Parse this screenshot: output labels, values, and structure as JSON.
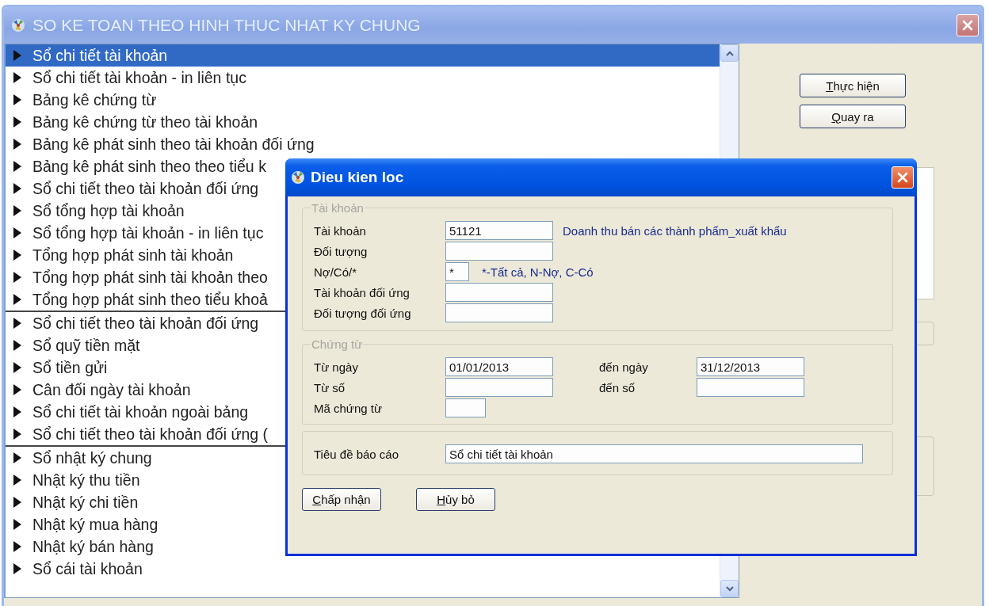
{
  "window": {
    "title": "SO KE TOAN THEO HINH THUC NHAT KY CHUNG"
  },
  "report_list": {
    "groups": [
      {
        "items": [
          {
            "label": "Sổ chi tiết tài khoản",
            "selected": true
          },
          {
            "label": "Sổ chi tiết tài khoản - in liên tục",
            "selected": false
          },
          {
            "label": "Bảng kê chứng từ",
            "selected": false
          },
          {
            "label": "Bảng kê chứng từ theo tài khoản",
            "selected": false
          },
          {
            "label": "Bảng kê phát sinh theo tài khoản đối ứng",
            "selected": false
          },
          {
            "label": "Bảng kê phát sinh theo theo tiểu k",
            "selected": false
          },
          {
            "label": "Sổ chi tiết theo tài khoản đối ứng",
            "selected": false
          },
          {
            "label": "Sổ tổng hợp tài khoản",
            "selected": false
          },
          {
            "label": "Sổ tổng hợp tài khoản - in liên tục",
            "selected": false
          },
          {
            "label": "Tổng hợp phát sinh tài khoản",
            "selected": false
          },
          {
            "label": "Tổng hợp phát sinh tài khoản theo",
            "selected": false
          },
          {
            "label": "Tổng hợp phát sinh theo tiểu khoả",
            "selected": false
          }
        ]
      },
      {
        "items": [
          {
            "label": "Sổ chi tiết theo tài khoản đối ứng",
            "selected": false
          },
          {
            "label": "Sổ quỹ tiền mặt",
            "selected": false
          },
          {
            "label": "Sổ tiền gửi",
            "selected": false
          },
          {
            "label": "Cân đối ngày tài khoản",
            "selected": false
          },
          {
            "label": "Sổ chi tiết tài khoản ngoài bảng",
            "selected": false
          },
          {
            "label": "Sổ chi tiết theo tài khoản đối ứng (",
            "selected": false
          }
        ]
      },
      {
        "items": [
          {
            "label": "Sổ nhật ký chung",
            "selected": false
          },
          {
            "label": "Nhật ký thu tiền",
            "selected": false
          },
          {
            "label": "Nhật ký chi tiền",
            "selected": false
          },
          {
            "label": "Nhật ký mua hàng",
            "selected": false
          },
          {
            "label": "Nhật ký bán hàng",
            "selected": false
          },
          {
            "label": "Sổ cái tài khoản",
            "selected": false
          }
        ]
      }
    ]
  },
  "side_buttons": [
    "Thực hiện",
    "Quay ra"
  ],
  "dialog": {
    "title": "Dieu kien loc",
    "account_group": {
      "legend": "Tài khoản",
      "fields": [
        {
          "label": "Tài khoản",
          "value": "51121",
          "kind": "medium",
          "note": "Doanh thu bán các thành phẩm_xuất khẩu"
        },
        {
          "label": "Đối tượng",
          "kind": "medium"
        },
        {
          "label": "Nợ/Có/*",
          "value": "*",
          "kind": "tiny",
          "note": "*-Tất cả, N-Nợ, C-Có"
        },
        {
          "label": "Tài khoản đối ứng",
          "kind": "medium"
        },
        {
          "label": "Đối tượng đối ứng",
          "kind": "medium"
        }
      ]
    },
    "voucher_group": {
      "legend": "Chứng từ",
      "rows": [
        {
          "label": "Từ ngày",
          "value": "01/01/2013",
          "kind": "range",
          "end_label": "đến ngày",
          "end_value": "31/12/2013"
        },
        {
          "label": "Từ số",
          "kind": "range",
          "end_label": "đến số"
        },
        {
          "label": "Mã chứng từ",
          "kind": "short"
        }
      ]
    },
    "report_title": {
      "label": "Tiêu đề báo cáo",
      "value": "Sổ chi tiết tài khoản"
    },
    "buttons": [
      "Chấp nhận",
      "Hủy bỏ"
    ]
  }
}
